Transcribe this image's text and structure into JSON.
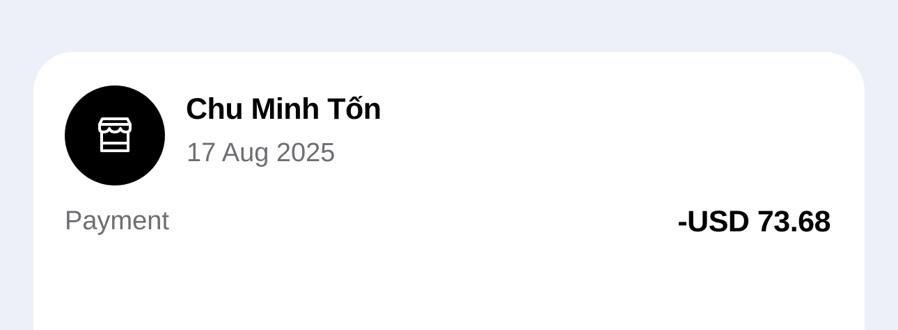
{
  "transaction": {
    "merchant_name": "Chu Minh Tốn",
    "date": "17 Aug 2025",
    "type": "Payment",
    "amount": "-USD 73.68",
    "icon": "storefront-icon"
  },
  "colors": {
    "background": "#eef0f9",
    "card": "#ffffff",
    "avatar": "#000000",
    "primary_text": "#000000",
    "secondary_text": "#6e6e73"
  }
}
